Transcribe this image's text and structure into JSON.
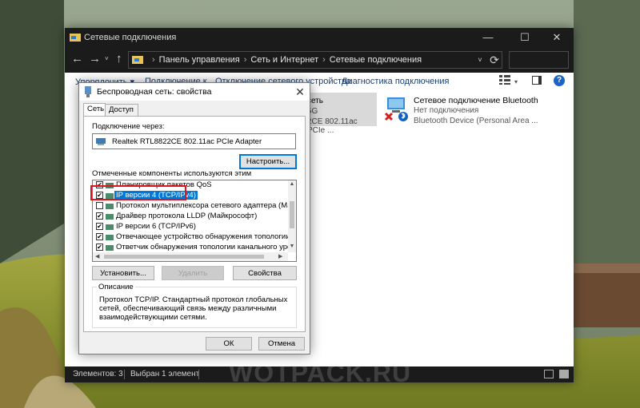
{
  "explorer": {
    "title": "Сетевые подключения",
    "window_controls": {
      "minimize": "—",
      "maximize": "☐",
      "close": "✕"
    },
    "nav": {
      "back": "←",
      "forward": "→",
      "history": "˅",
      "up": "↑"
    },
    "address": {
      "crumbs": [
        "Панель управления",
        "Сеть и Интернет",
        "Сетевые подключения"
      ],
      "dropdown": "˅",
      "refresh": "⟳"
    },
    "commands": {
      "organize": "Упорядочить ▾",
      "connect": "Подключение к",
      "disconnect": "Отключение сетевого устройства",
      "diagnostics": "Диагностика подключения",
      "view_dropdown": "▾",
      "help": "?"
    },
    "connections": [
      {
        "name": "сеть",
        "line2": "5G",
        "line3": "2CE 802.11ac PCIe ..."
      },
      {
        "name": "Сетевое подключение Bluetooth",
        "status": "Нет подключения",
        "device": "Bluetooth Device (Personal Area ..."
      }
    ],
    "status": {
      "count": "Элементов: 3",
      "selected": "Выбран 1 элемент"
    }
  },
  "watermark": "WOTPACK.RU",
  "dialog": {
    "title": "Беспроводная сеть: свойства",
    "close": "✕",
    "tabs": [
      "Сеть",
      "Доступ"
    ],
    "connect_via_label": "Подключение через:",
    "adapter": "Realtek RTL8822CE 802.11ac PCIe Adapter",
    "configure_button": "Настроить...",
    "components_label": "Отмеченные компоненты используются этим подключением:",
    "components": [
      {
        "label": "Планировщик пакетов QoS",
        "checked": true
      },
      {
        "label": "IP версии 4 (TCP/IPv4)",
        "checked": true,
        "selected": true
      },
      {
        "label": "Протокол мультиплексора сетевого адаптера (Майкр",
        "checked": false
      },
      {
        "label": "Драйвер протокола LLDP (Майкрософт)",
        "checked": true
      },
      {
        "label": "IP версии 6 (TCP/IPv6)",
        "checked": true
      },
      {
        "label": "Отвечающее устройство обнаружения топологии кана",
        "checked": true
      },
      {
        "label": "Ответчик обнаружения топологии канального уровня",
        "checked": true
      }
    ],
    "install_button": "Установить...",
    "remove_button": "Удалить",
    "properties_button": "Свойства",
    "description_label": "Описание",
    "description": "Протокол TCP/IP. Стандартный протокол глобальных сетей, обеспечивающий связь между различными взаимодействующими сетями.",
    "ok_button": "ОК",
    "cancel_button": "Отмена"
  },
  "colors": {
    "accent": "#0078d7",
    "highlight_frame": "#e0121b",
    "titlebar_dark": "#1b1b1b"
  }
}
